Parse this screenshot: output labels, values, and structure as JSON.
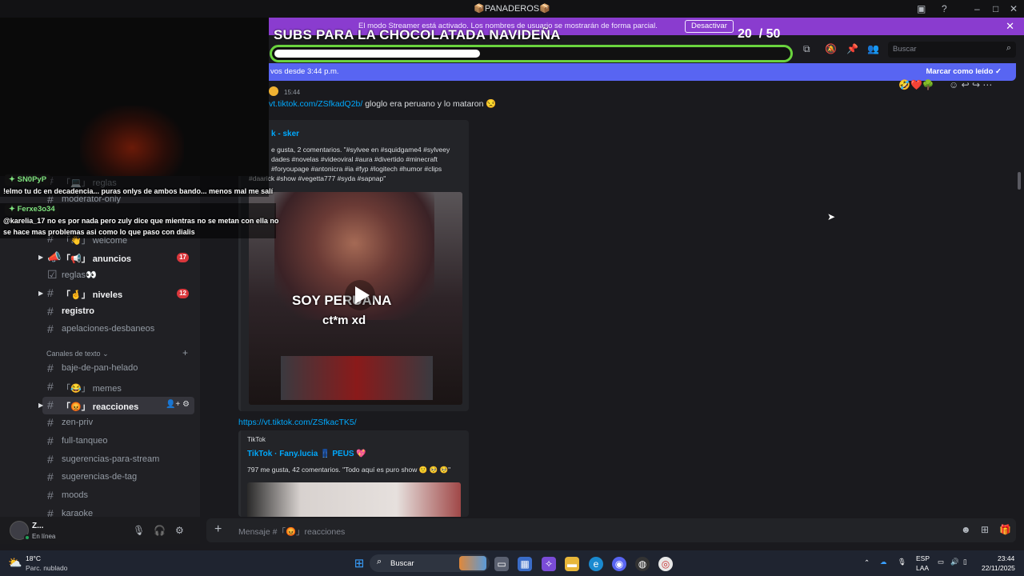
{
  "window": {
    "title": "📦PANADEROS📦"
  },
  "streamer_banner": {
    "message": "El modo Streamer está activado. Los nombres de usuario se mostrarán de forma parcial.",
    "button": "Desactivar"
  },
  "stream_overlay": {
    "goal_title": "SUBS PARA LA CHOCOLATADA NAVIDEÑA",
    "goal_current": "20",
    "goal_total": "/ 50",
    "goal_progress_fraction": 0.4,
    "chat": [
      {
        "user": "SN0PyP",
        "text": "!elmo tu dc en decadencia... puras onlys de ambos bando... menos mal me salí"
      },
      {
        "user": "Ferxe3o34",
        "text_1": "@karelia_17 no es por nada pero zuly dice que mientras no se metan con ella no",
        "text_2": "se hace mas problemas asi como lo que paso con dialis"
      }
    ]
  },
  "header": {
    "search_placeholder": "Buscar"
  },
  "new_messages": {
    "text": "vos desde 3:44 p.m.",
    "mark_read": "Marcar como leído"
  },
  "sidebar": {
    "channels": [
      {
        "name": "reglas",
        "prefix": "「💻」"
      },
      {
        "name": "moderator-only"
      },
      {
        "name": "welcome",
        "prefix": "「👋」"
      },
      {
        "name": "anuncios",
        "prefix": "「📢」",
        "badge": "17"
      },
      {
        "name": "reglas👀"
      },
      {
        "name": "niveles",
        "prefix": "「🤞」",
        "badge": "12"
      },
      {
        "name": "registro"
      },
      {
        "name": "apelaciones-desbaneos"
      }
    ],
    "category": "Canales de texto",
    "text_channels": [
      {
        "name": "baje-de-pan-helado"
      },
      {
        "name": "memes",
        "prefix": "「😂」"
      },
      {
        "name": "reacciones",
        "prefix": "「😡」"
      },
      {
        "name": "zen-priv"
      },
      {
        "name": "full-tanqueo"
      },
      {
        "name": "sugerencias-para-stream"
      },
      {
        "name": "sugerencias-de-tag"
      },
      {
        "name": "moods"
      },
      {
        "name": "karaoke"
      }
    ]
  },
  "user": {
    "name": "Z...",
    "status": "En línea"
  },
  "messages": [
    {
      "time": "15:44",
      "link": "vt.tiktok.com/ZSfkadQ2b/",
      "text": "gloglo era peruano y lo mataron 😒",
      "embed": {
        "title": "k - sker",
        "desc_1": "e gusta, 2 comentarios. \"#sylvee en #squidgame4 #sylveey",
        "desc_2": "dades #novelas #videoviral #aura #divertido #minecraft",
        "desc_3": "#foryoupage #antonicra #ia #fyp #logitech #humor #clips",
        "desc_4": "#daarick #show #vegetta777 #syda #sapnap\"",
        "video_text_1": "SOY PERUANA",
        "video_text_2": "ct*m xd"
      }
    },
    {
      "link": "https://vt.tiktok.com/ZSfkacTK5/",
      "embed": {
        "provider": "TikTok",
        "title": "TikTok · Fany.lucia 👖 PEUS 💖",
        "desc": "797 me gusta, 42 comentarios. \"Todo aquí es puro show 🙂 🥺 🥺\""
      }
    }
  ],
  "composer": {
    "placeholder": "Mensaje #「😡」reacciones"
  },
  "taskbar": {
    "weather_temp": "18°C",
    "weather_desc": "Parc. nublado",
    "search": "Buscar",
    "lang_1": "ESP",
    "lang_2": "LAA",
    "time": "23:44",
    "date": "22/11/2025"
  }
}
